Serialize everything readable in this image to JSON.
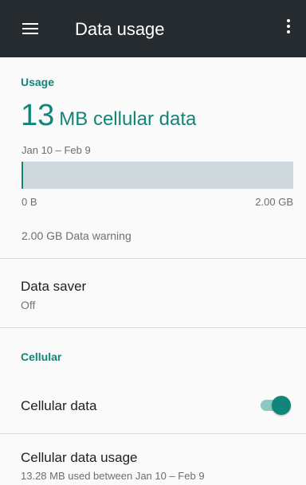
{
  "appbar": {
    "title": "Data usage",
    "menu_icon": "menu-icon",
    "more_icon": "more-vert-icon"
  },
  "usage": {
    "section_label": "Usage",
    "amount": "13",
    "amount_label": "MB cellular data",
    "period": "Jan 10 – Feb 9",
    "bar_fraction": 0.0065,
    "bar_min_label": "0 B",
    "bar_max_label": "2.00 GB",
    "warning": "2.00 GB Data warning"
  },
  "data_saver": {
    "title": "Data saver",
    "status": "Off"
  },
  "cellular": {
    "section_label": "Cellular",
    "cellular_data_label": "Cellular data",
    "cellular_data_enabled": true,
    "usage_title": "Cellular data usage",
    "usage_subtitle": "13.28 MB used between Jan 10 – Feb 9"
  },
  "colors": {
    "accent": "#12857a",
    "appbar": "#262b30",
    "bar_track": "#cfd8dc"
  }
}
